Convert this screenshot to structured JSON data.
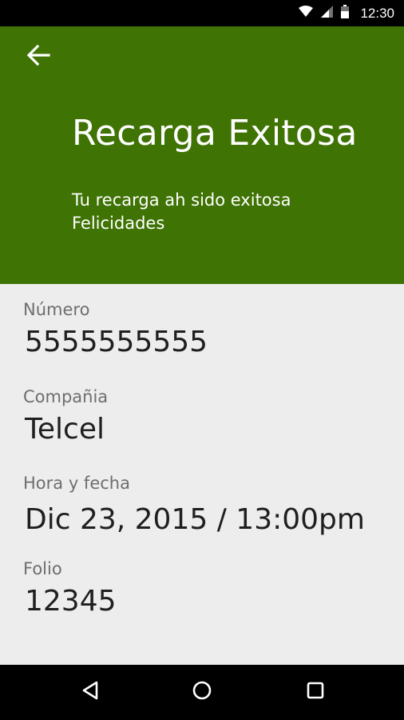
{
  "status_bar": {
    "time": "12:30",
    "icons": [
      "wifi-icon",
      "cell-signal-icon",
      "battery-icon"
    ]
  },
  "header": {
    "back_icon": "arrow-left-icon",
    "title": "Recarga Exitosa",
    "subtitle_line1": "Tu recarga ah sido exitosa",
    "subtitle_line2": "Felicidades",
    "background_color": "#3f7304"
  },
  "details": {
    "numero": {
      "label": "Número",
      "value": "5555555555"
    },
    "compania": {
      "label": "Compañia",
      "value": "Telcel"
    },
    "hora_fecha": {
      "label": "Hora y fecha",
      "value": "Dic 23, 2015 / 13:00pm"
    },
    "folio": {
      "label": "Folio",
      "value": "12345"
    }
  },
  "nav_bar": {
    "icons": [
      "back-triangle-icon",
      "home-circle-icon",
      "recents-square-icon"
    ]
  }
}
